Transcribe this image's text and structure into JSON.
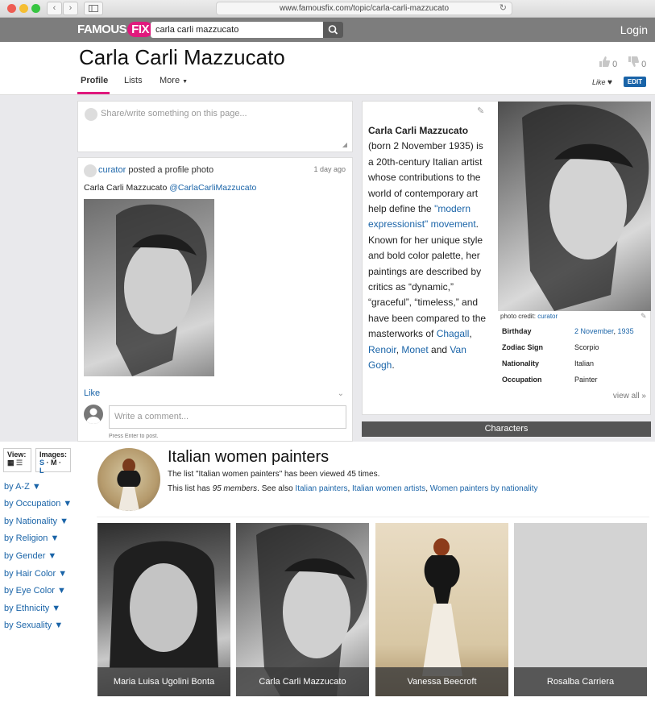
{
  "browser": {
    "url": "www.famousfix.com/topic/carla-carli-mazzucato"
  },
  "header": {
    "logo_part1": "FAMOUS",
    "logo_part2": "FIX",
    "search_value": "carla carli mazzucato",
    "login_label": "Login"
  },
  "page": {
    "title": "Carla Carli Mazzucato",
    "tabs": [
      {
        "label": "Profile"
      },
      {
        "label": "Lists"
      },
      {
        "label": "More"
      }
    ],
    "thumbs_up_count": "0",
    "thumbs_down_count": "0",
    "like_label": "Like",
    "edit_label": "EDIT"
  },
  "share": {
    "placeholder": "Share/write something on this page..."
  },
  "post": {
    "author": "curator",
    "action": "posted a profile photo",
    "time": "1 day ago",
    "caption_text": "Carla Carli Mazzucato",
    "caption_handle": "@CarlaCarliMazzucato",
    "like_label": "Like",
    "comment_placeholder": "Write a comment...",
    "enter_hint": "Press Enter to post."
  },
  "bio": {
    "name": "Carla Carli Mazzucato",
    "t1": " (born 2 November 1935) is a 20th-century Italian artist whose contributions to the world of contemporary art help define the ",
    "l1": "\"modern expressionist\" movement",
    "t2": ". Known for her unique style and bold color palette, her paintings are described by critics as “dynamic,” “graceful”, “timeless,” and have been compared to the masterworks of ",
    "l2": "Chagall",
    "t3": ", ",
    "l3": "Renoir",
    "t4": ", ",
    "l4": "Monet",
    "t5": " and ",
    "l5": "Van Gogh",
    "t6": "."
  },
  "infobox": {
    "photo_credit_label": "photo credit:",
    "photo_credit_link": "curator",
    "facts": [
      {
        "key": "Birthday",
        "value": "2 November",
        "value2": "1935"
      },
      {
        "key": "Zodiac Sign",
        "value": "Scorpio",
        "value2": ""
      },
      {
        "key": "Nationality",
        "value": "Italian",
        "value2": ""
      },
      {
        "key": "Occupation",
        "value": "Painter",
        "value2": ""
      }
    ],
    "view_all": "view all »"
  },
  "characters_label": "Characters",
  "sidebar": {
    "view_label": "View:",
    "images_label": "Images:",
    "sizes": [
      "S",
      "M",
      "L"
    ],
    "filters": [
      "by A-Z ▼",
      "by Occupation ▼",
      "by Nationality ▼",
      "by Religion ▼",
      "by Gender ▼",
      "by Hair Color ▼",
      "by Eye Color ▼",
      "by Ethnicity ▼",
      "by Sexuality ▼"
    ]
  },
  "list": {
    "title": "Italian women painters",
    "views_text": "The list \"Italian women painters\" has been viewed 45 times.",
    "members_pre": "This list has ",
    "members_count": "95 members",
    "members_post": ". See also ",
    "see_also": [
      "Italian painters",
      "Italian women artists",
      "Women painters by nationality"
    ],
    "members": [
      {
        "name": "Maria Luisa Ugolini Bonta"
      },
      {
        "name": "Carla Carli Mazzucato"
      },
      {
        "name": "Vanessa Beecroft"
      },
      {
        "name": "Rosalba Carriera"
      }
    ]
  },
  "colors": {
    "brand_pink": "#e0197d",
    "link_blue": "#1a64a8",
    "header_grey": "#7d7d7d"
  }
}
